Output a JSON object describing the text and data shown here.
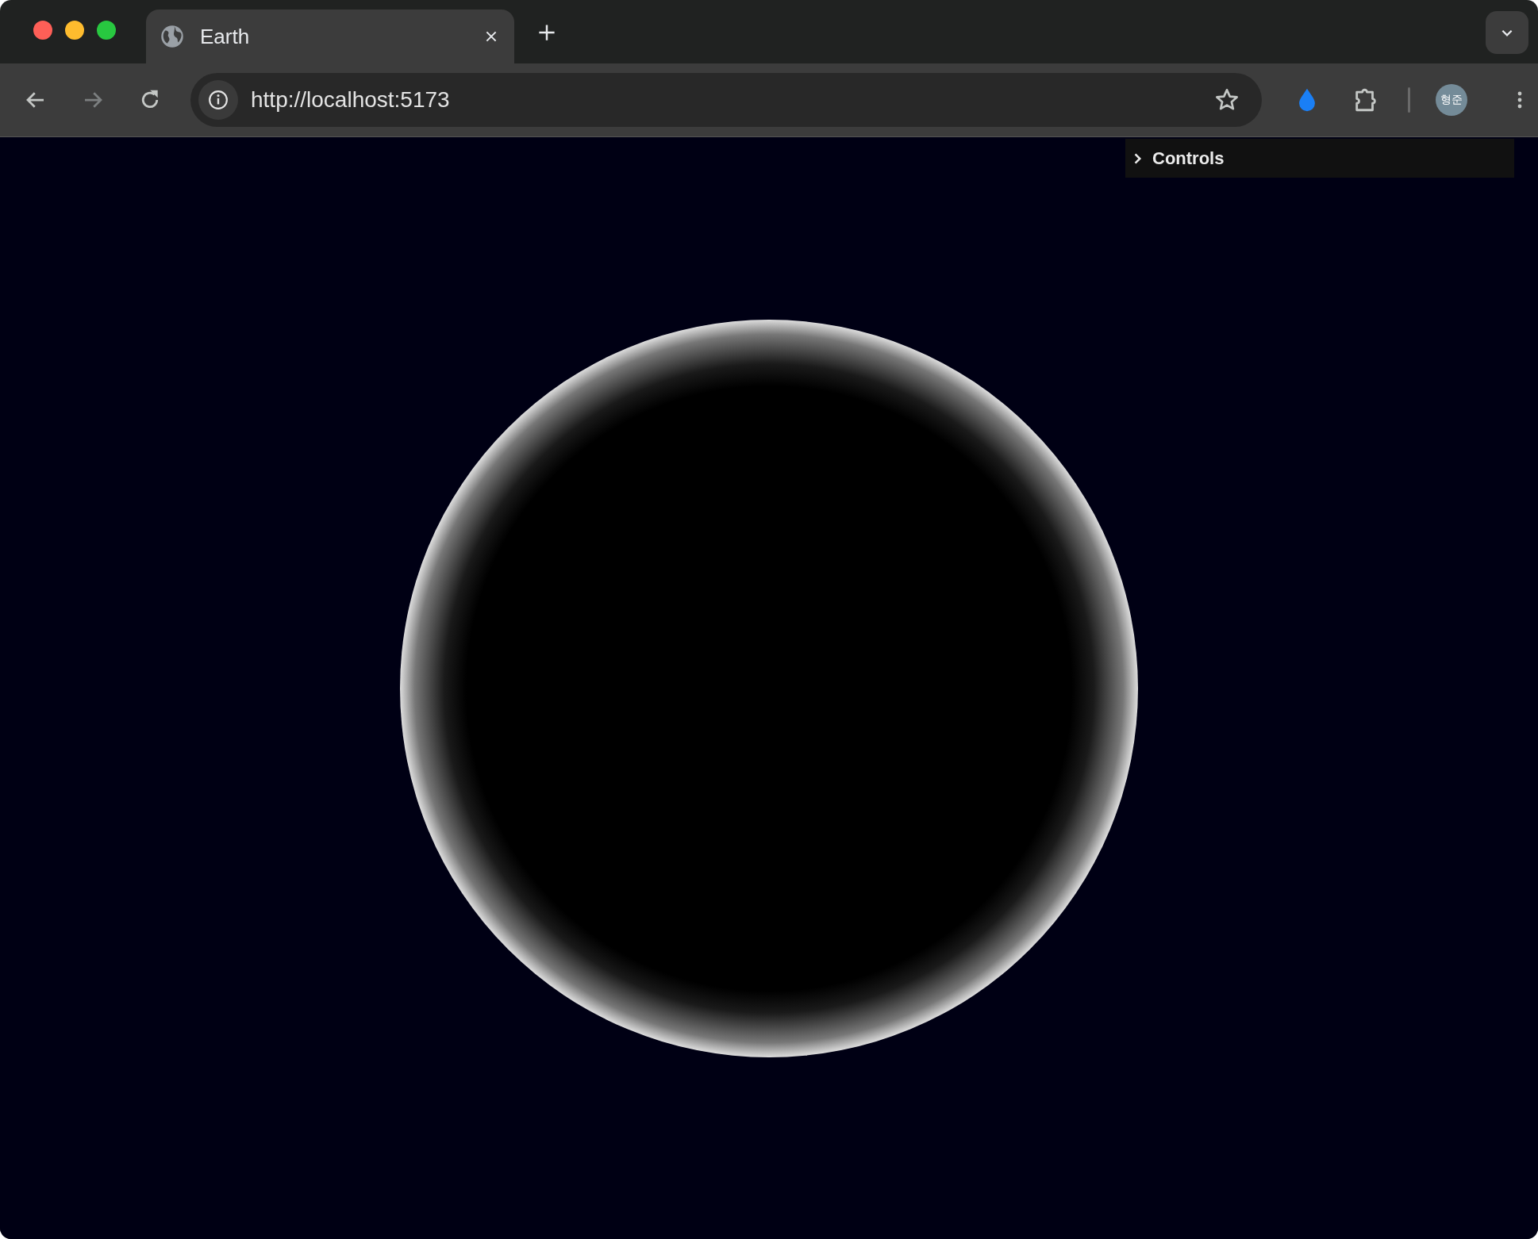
{
  "tab": {
    "title": "Earth",
    "selected": true
  },
  "address_bar": {
    "url": "http://localhost:5173"
  },
  "profile": {
    "initials": "형준"
  },
  "controls_panel": {
    "title": "Controls",
    "expanded": false
  }
}
